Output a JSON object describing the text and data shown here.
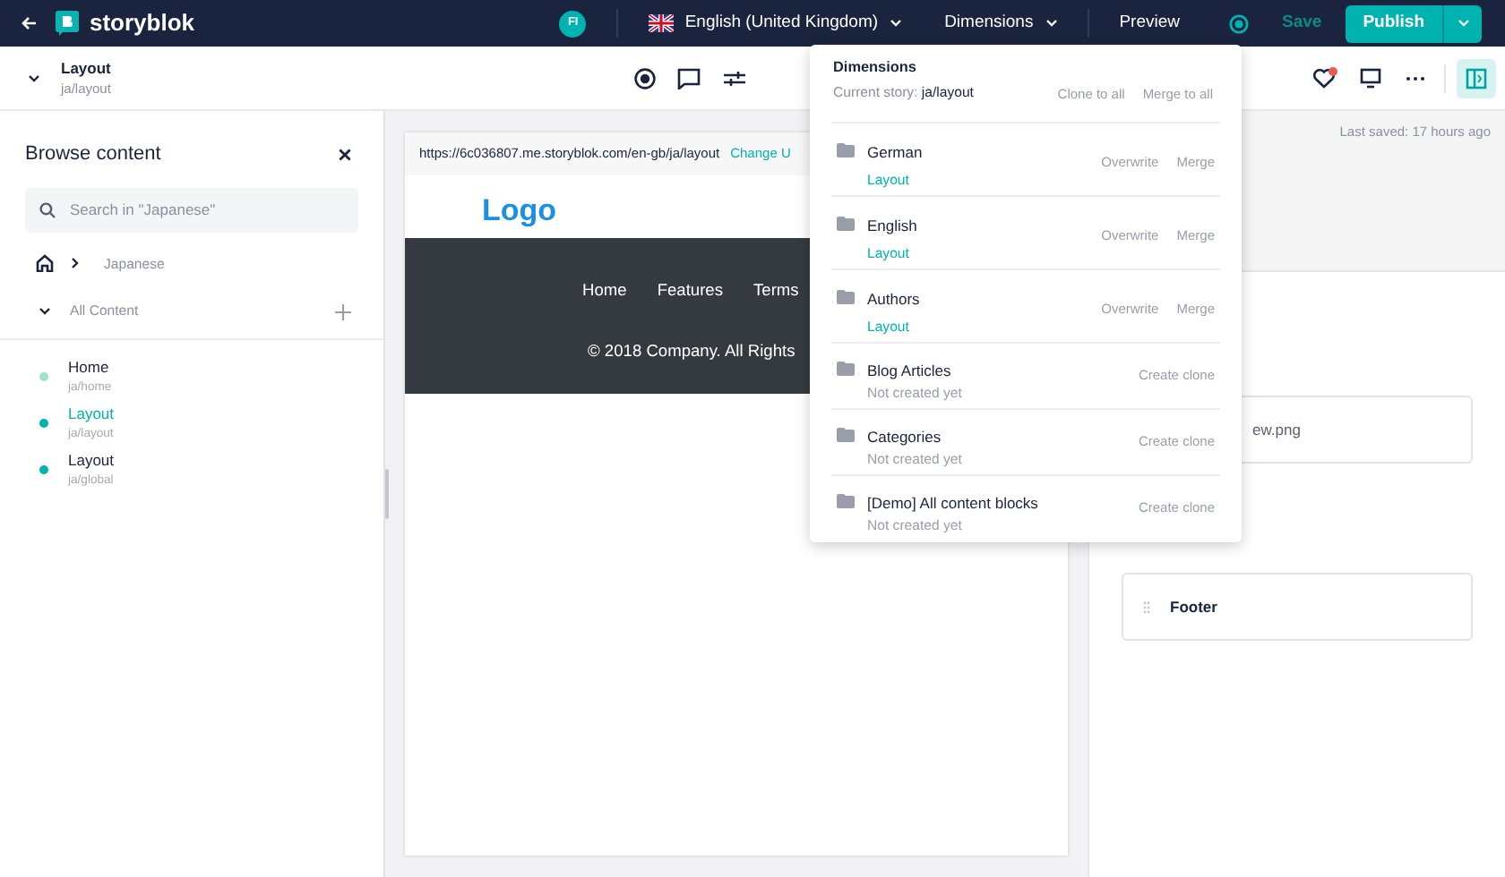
{
  "topbar": {
    "brand": "storyblok",
    "avatar": "FI",
    "language": "English (United Kingdom)",
    "dimensions": "Dimensions",
    "preview": "Preview",
    "save": "Save",
    "publish": "Publish"
  },
  "story": {
    "title": "Layout",
    "slug": "ja/layout"
  },
  "sidebar": {
    "title": "Browse content",
    "search_placeholder": "Search in \"Japanese\"",
    "breadcrumb": "Japanese",
    "folder": "All Content",
    "items": [
      {
        "name": "Home",
        "slug": "ja/home",
        "selected": false,
        "color": "#9ee0cf"
      },
      {
        "name": "Layout",
        "slug": "ja/layout",
        "selected": true,
        "color": "#00b3b0"
      },
      {
        "name": "Layout",
        "slug": "ja/global",
        "selected": false,
        "color": "#00b3b0"
      }
    ]
  },
  "preview": {
    "url": "https://6c036807.me.storyblok.com/en-gb/ja/layout",
    "change_url": "Change U",
    "logo": "Logo",
    "nav": [
      "Home",
      "Features",
      "Terms"
    ],
    "copyright": "© 2018 Company. All Rights"
  },
  "dimensions_menu": {
    "title": "Dimensions",
    "current_label": "Current story:",
    "current": "ja/layout",
    "clone_all": "Clone to all",
    "merge_all": "Merge to all",
    "items": [
      {
        "name": "German",
        "status": "Layout",
        "kind": "exists",
        "actions": [
          "Overwrite",
          "Merge"
        ]
      },
      {
        "name": "English",
        "status": "Layout",
        "kind": "exists",
        "actions": [
          "Overwrite",
          "Merge"
        ]
      },
      {
        "name": "Authors",
        "status": "Layout",
        "kind": "exists",
        "actions": [
          "Overwrite",
          "Merge"
        ]
      },
      {
        "name": "Blog Articles",
        "status": "Not created yet",
        "kind": "missing",
        "actions": [
          "Create clone"
        ]
      },
      {
        "name": "Categories",
        "status": "Not created yet",
        "kind": "missing",
        "actions": [
          "Create clone"
        ]
      },
      {
        "name": "[Demo] All content blocks",
        "status": "Not created yet",
        "kind": "missing",
        "actions": [
          "Create clone"
        ]
      }
    ]
  },
  "content_panel": {
    "last_saved": "Last saved: 17 hours ago",
    "asset_name": "ew.png",
    "blocks": [
      "Footer"
    ]
  }
}
